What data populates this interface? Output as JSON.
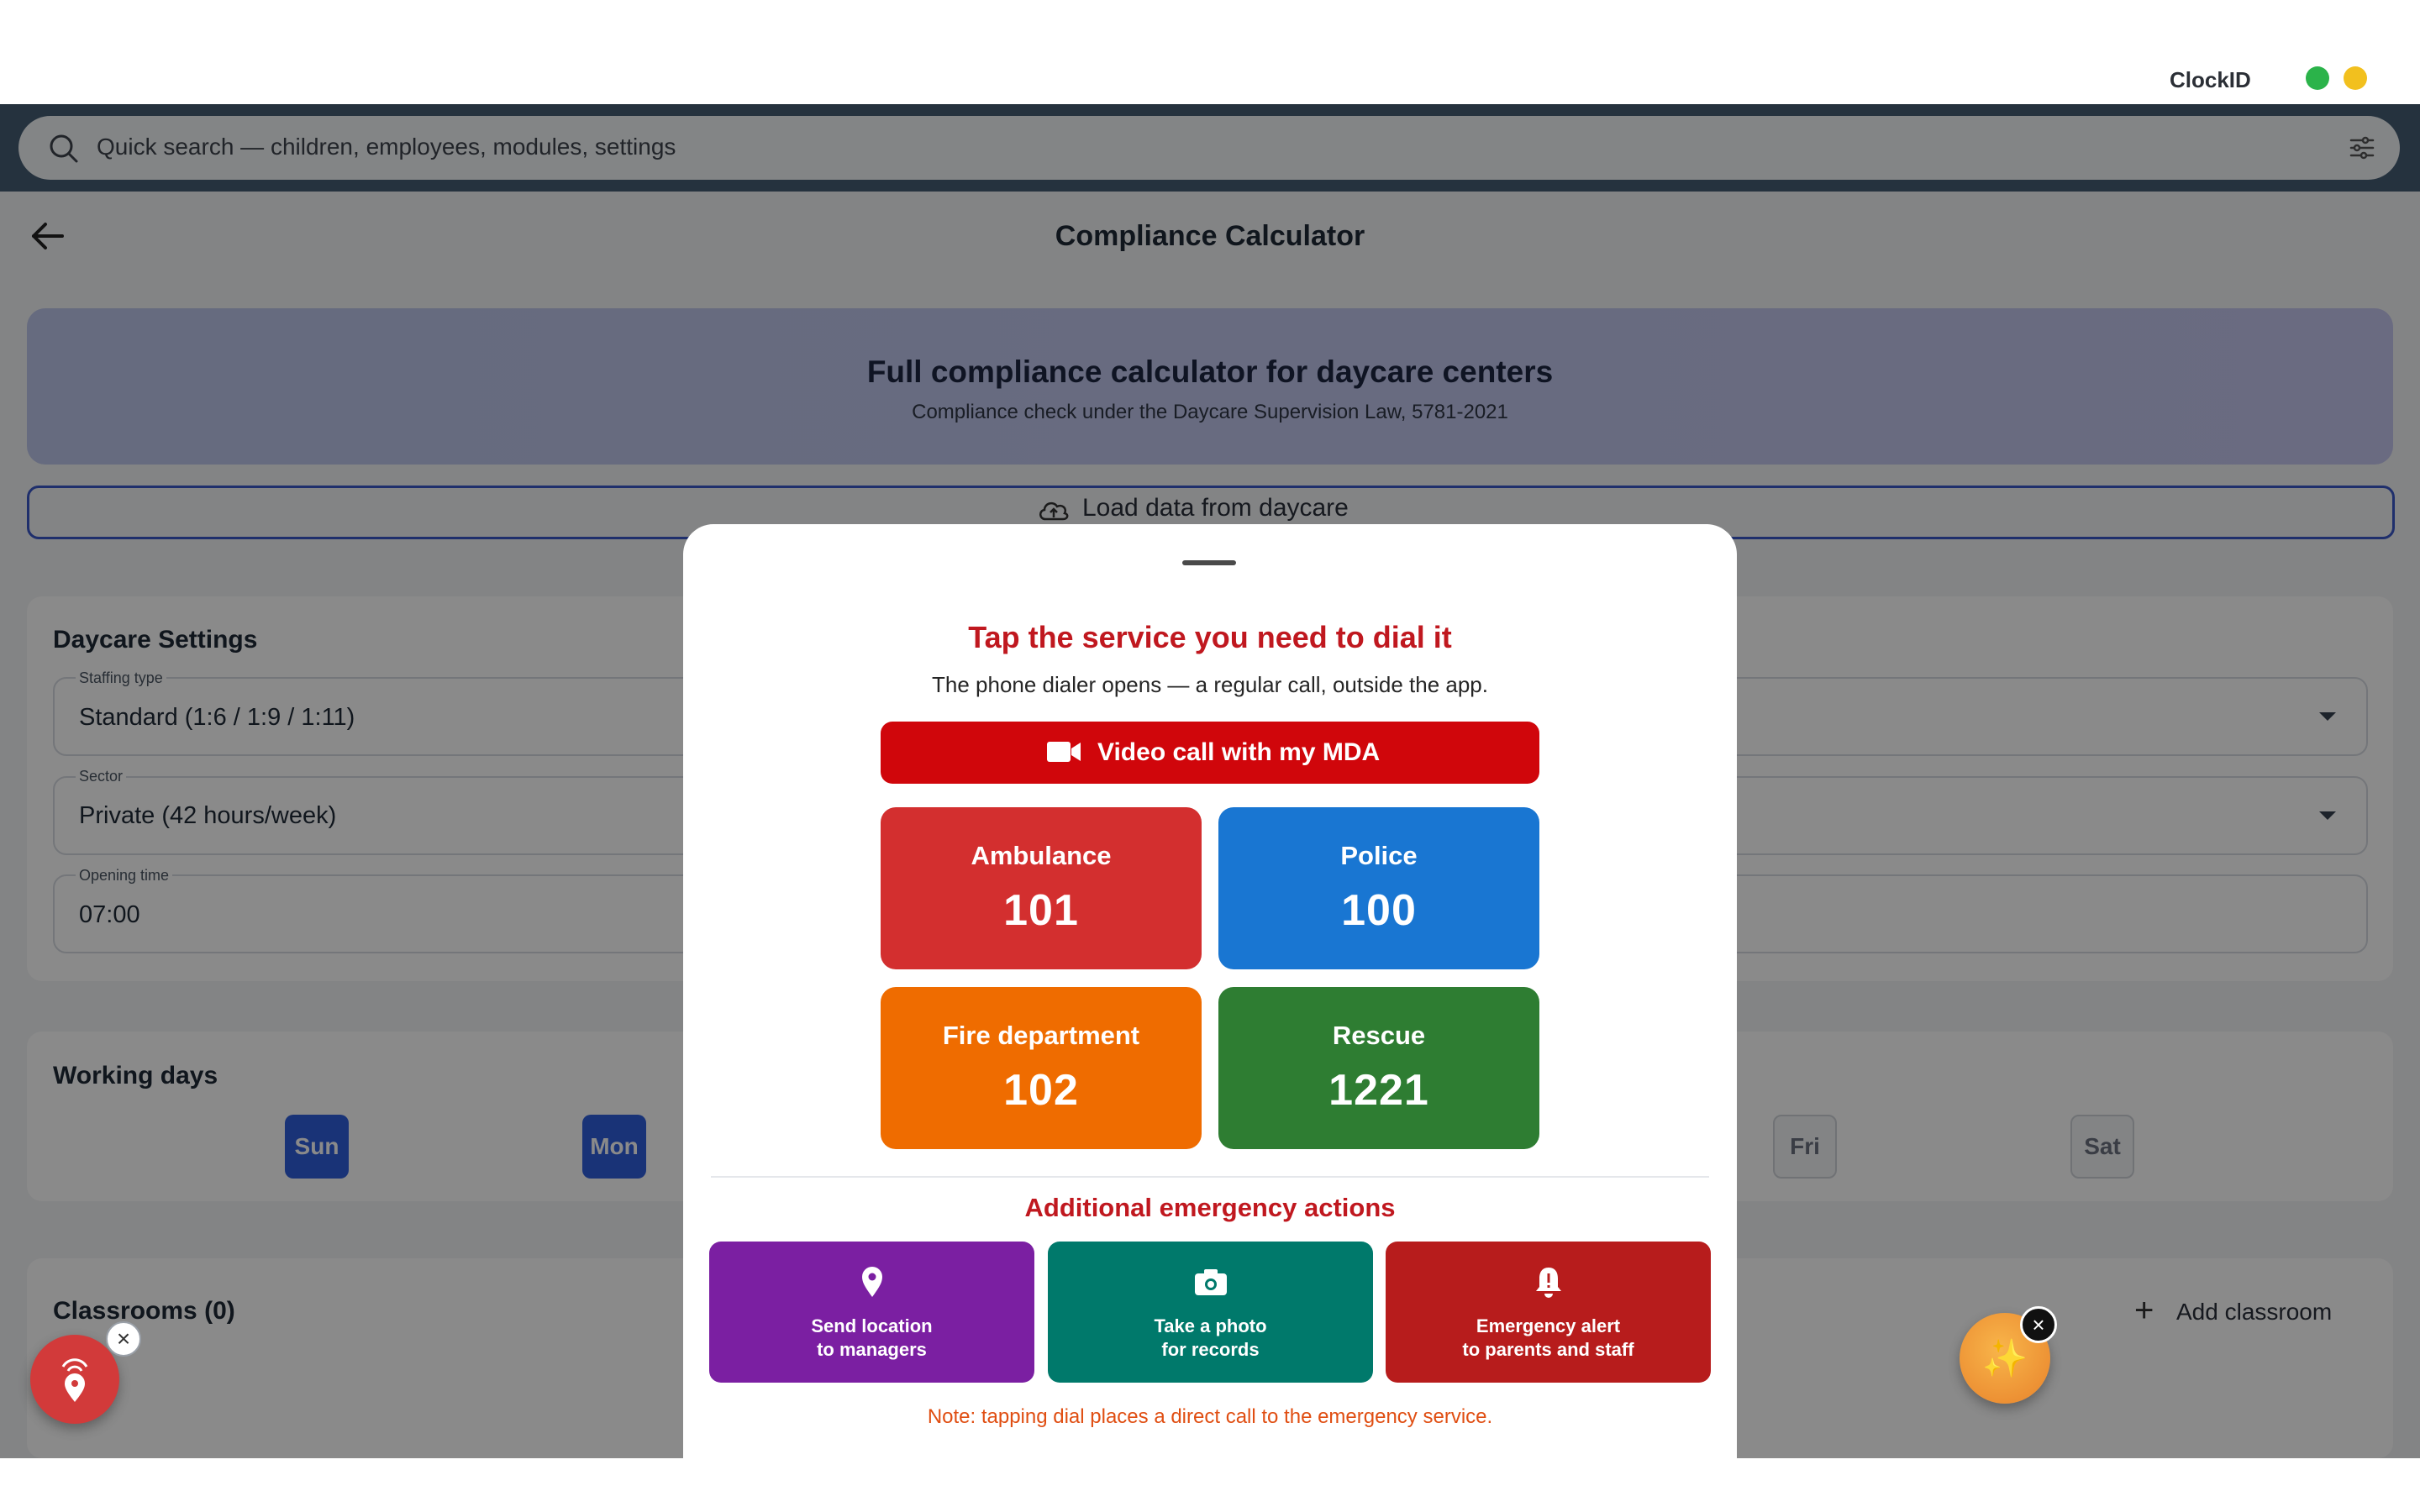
{
  "window": {
    "app_name": "ClockID",
    "status_colors": [
      "#2bb34a",
      "#f2c01e"
    ]
  },
  "search": {
    "placeholder": "Quick search — children, employees, modules, settings",
    "search_icon": "search-icon",
    "filter_icon": "sliders-icon"
  },
  "page": {
    "title": "Compliance Calculator",
    "hero_title": "Full compliance calculator for daycare centers",
    "hero_subtitle": "Compliance check under the Daycare Supervision Law, 5781-2021",
    "load_button": "Load data from daycare"
  },
  "settings": {
    "title": "Daycare Settings",
    "fields": [
      {
        "label": "Staffing type",
        "value": "Standard (1:6 / 1:9 / 1:11)"
      },
      {
        "label": "Sector",
        "value": "Private (42 hours/week)"
      },
      {
        "label": "Opening time",
        "value": "07:00"
      }
    ]
  },
  "working_days": {
    "title": "Working days",
    "days": [
      {
        "label": "Sun",
        "active": true
      },
      {
        "label": "Mon",
        "active": true
      },
      {
        "label": "Fri",
        "active": false
      },
      {
        "label": "Sat",
        "active": false
      }
    ]
  },
  "classrooms": {
    "title": "Classrooms (0)",
    "add_button": "Add classroom"
  },
  "emergency": {
    "title": "Tap the service you need to dial it",
    "subtitle": "The phone dialer opens — a regular call, outside the app.",
    "video_call": "Video call with my MDA",
    "services": [
      {
        "name": "Ambulance",
        "number": "101",
        "color": "#d32f2f"
      },
      {
        "name": "Police",
        "number": "100",
        "color": "#1976d2"
      },
      {
        "name": "Fire department",
        "number": "102",
        "color": "#ef6c00"
      },
      {
        "name": "Rescue",
        "number": "1221",
        "color": "#2e7d32"
      }
    ],
    "additional_title": "Additional emergency actions",
    "actions": [
      {
        "line1": "Send location",
        "line2": "to managers",
        "icon": "location-pin-icon",
        "color": "#7b1fa2"
      },
      {
        "line1": "Take a photo",
        "line2": "for records",
        "icon": "camera-icon",
        "color": "#00796b"
      },
      {
        "line1": "Emergency alert",
        "line2": "to parents and staff",
        "icon": "bell-alert-icon",
        "color": "#b71c1c"
      }
    ],
    "note": "Note: tapping dial places a direct call to the emergency service."
  }
}
